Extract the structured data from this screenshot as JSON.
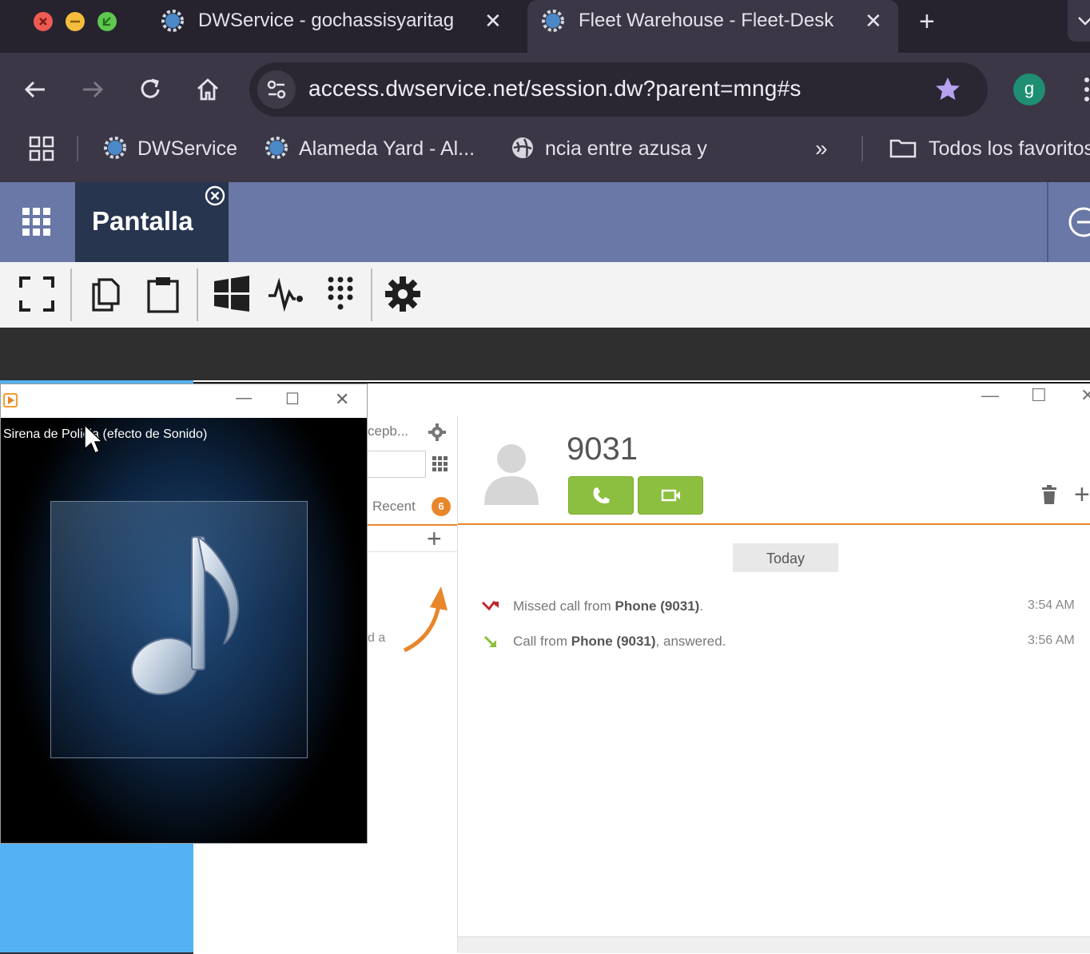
{
  "browser": {
    "tabs": [
      {
        "title": "DWService - gochassisyaritag",
        "active": false
      },
      {
        "title": "Fleet Warehouse - Fleet-Desk",
        "active": true
      }
    ],
    "address": "access.dwservice.net/session.dw?parent=mng#s",
    "profile_initial": "g",
    "bookmarks": [
      {
        "label": "DWService",
        "icon": "dwservice-icon"
      },
      {
        "label": "Alameda Yard - Al...",
        "icon": "dwservice-icon"
      },
      {
        "label": "ncia entre azusa y",
        "icon": "globe-icon"
      }
    ],
    "all_bookmarks_label": "Todos los favoritos"
  },
  "dwservice": {
    "tab_label": "Pantalla",
    "tools": [
      "fullscreen-icon",
      "copy-icon",
      "clipboard-icon",
      "windows-icon",
      "activity-icon",
      "keypad-icon",
      "settings-icon"
    ]
  },
  "softphone": {
    "contact_truncated": "cepb...",
    "recent_label": "Recent",
    "recent_badge": "6",
    "side_text": "d a",
    "contact_number": "9031",
    "date_divider": "Today",
    "calls": [
      {
        "pre": "Missed call from ",
        "who": "Phone (9031)",
        "post": ".",
        "time": "3:54 AM",
        "type": "missed",
        "color": "#c0262d"
      },
      {
        "pre": "Call from ",
        "who": "Phone (9031)",
        "post": ", answered.",
        "time": "3:56 AM",
        "type": "answered",
        "color": "#8cbf3f"
      }
    ],
    "accent": "#e8862a"
  },
  "media_player": {
    "track": "Sirena de Policia (efecto de Sonido)"
  }
}
